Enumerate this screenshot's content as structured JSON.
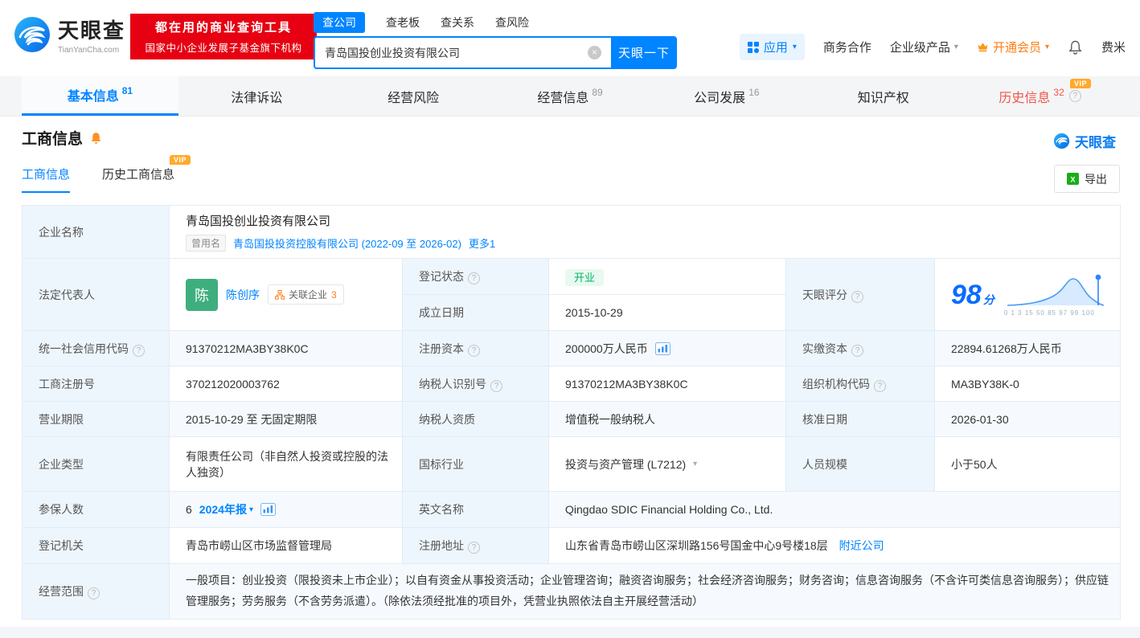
{
  "icons": {
    "help": "?",
    "caret_down": "▾",
    "clear": "×"
  },
  "colors": {
    "brand_blue": "#0084ff",
    "banner_red": "#e60012",
    "vip_gold": "#ffaa2c",
    "history_red": "#f2564a",
    "status_green": "#00b365",
    "member_orange": "#ff7e14",
    "label_bg": "#eef6fd"
  },
  "header": {
    "logo": {
      "name": "天眼查",
      "domain": "TianYanCha.com"
    },
    "banner": {
      "line1": "都在用的商业查询工具",
      "line2": "国家中小企业发展子基金旗下机构"
    },
    "search": {
      "tabs": [
        {
          "label": "查公司"
        },
        {
          "label": "查老板"
        },
        {
          "label": "查关系"
        },
        {
          "label": "查风险"
        }
      ],
      "value": "青岛国投创业投资有限公司",
      "button": "天眼一下"
    },
    "nav": {
      "apps": "应用",
      "cooperation": "商务合作",
      "enterprise": "企业级产品",
      "vip": "开通会员",
      "user": "费米"
    }
  },
  "tabs": [
    {
      "label": "基本信息",
      "count": "81"
    },
    {
      "label": "法律诉讼",
      "count": ""
    },
    {
      "label": "经营风险",
      "count": ""
    },
    {
      "label": "经营信息",
      "count": "89"
    },
    {
      "label": "公司发展",
      "count": "16"
    },
    {
      "label": "知识产权",
      "count": ""
    },
    {
      "label": "历史信息",
      "count": "32"
    }
  ],
  "section": {
    "title": "工商信息",
    "brand": "天眼查",
    "subtab_active": "工商信息",
    "subtab_history": "历史工商信息",
    "vip": "VIP",
    "export": "导出"
  },
  "company": {
    "name_label": "企业名称",
    "name": "青岛国投创业投资有限公司",
    "former_badge": "曾用名",
    "former_name": "青岛国投投资控股有限公司 (2022-09 至 2026-02)",
    "more": "更多1",
    "legal_label": "法定代表人",
    "avatar": "陈",
    "legal_name": "陈创序",
    "related": "关联企业",
    "related_count": "3",
    "status_label": "登记状态",
    "status": "开业",
    "established_label": "成立日期",
    "established": "2015-10-29",
    "score_label": "天眼评分",
    "score": "98",
    "score_unit": "分",
    "score_axis": "0 1 3 15 50 85 97 99 100"
  },
  "fields": {
    "credit_code_label": "统一社会信用代码",
    "credit_code": "91370212MA3BY38K0C",
    "reg_capital_label": "注册资本",
    "reg_capital": "200000万人民币",
    "paid_capital_label": "实缴资本",
    "paid_capital": "22894.61268万人民币",
    "reg_no_label": "工商注册号",
    "reg_no": "370212020003762",
    "tax_id_label": "纳税人识别号",
    "tax_id": "91370212MA3BY38K0C",
    "org_code_label": "组织机构代码",
    "org_code": "MA3BY38K-0",
    "term_label": "营业期限",
    "term": "2015-10-29 至 无固定期限",
    "tax_type_label": "纳税人资质",
    "tax_type": "增值税一般纳税人",
    "approve_date_label": "核准日期",
    "approve_date": "2026-01-30",
    "type_label": "企业类型",
    "type": "有限责任公司（非自然人投资或控股的法人独资）",
    "industry_label": "国标行业",
    "industry": "投资与资产管理 (L7212)",
    "staff_label": "人员规模",
    "staff": "小于50人",
    "insured_label": "参保人数",
    "insured": "6",
    "annual_report": "2024年报",
    "en_name_label": "英文名称",
    "en_name": "Qingdao SDIC Financial Holding Co., Ltd.",
    "authority_label": "登记机关",
    "authority": "青岛市崂山区市场监督管理局",
    "address_label": "注册地址",
    "address": "山东省青岛市崂山区深圳路156号国金中心9号楼18层",
    "nearby": "附近公司",
    "scope_label": "经营范围",
    "scope": "一般项目：创业投资（限投资未上市企业）；以自有资金从事投资活动；企业管理咨询；融资咨询服务；社会经济咨询服务；财务咨询；信息咨询服务（不含许可类信息咨询服务）；供应链管理服务；劳务服务（不含劳务派遣）。（除依法须经批准的项目外，凭营业执照依法自主开展经营活动）"
  }
}
